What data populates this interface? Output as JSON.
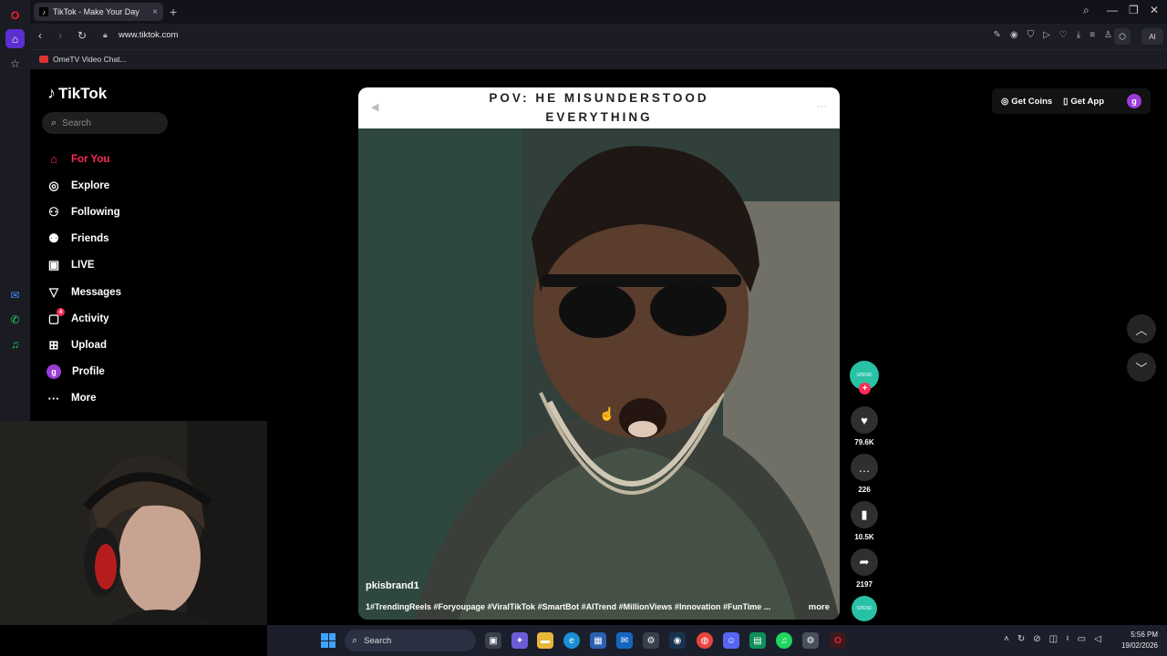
{
  "browser": {
    "tab_title": "TikTok - Make Your Day",
    "url": "www.tiktok.com",
    "bookmark": "OmeTV Video Chat...",
    "ai_label": "AI"
  },
  "tiktok": {
    "logo": "TikTok",
    "search_placeholder": "Search",
    "nav": [
      {
        "label": "For You",
        "icon": "home-icon"
      },
      {
        "label": "Explore",
        "icon": "compass-icon"
      },
      {
        "label": "Following",
        "icon": "following-icon"
      },
      {
        "label": "Friends",
        "icon": "friends-icon"
      },
      {
        "label": "LIVE",
        "icon": "live-icon"
      },
      {
        "label": "Messages",
        "icon": "messages-icon"
      },
      {
        "label": "Activity",
        "icon": "activity-icon",
        "badge": "4"
      },
      {
        "label": "Upload",
        "icon": "upload-icon"
      },
      {
        "label": "Profile",
        "icon": "profile-avatar",
        "avatar": "g"
      },
      {
        "label": "More",
        "icon": "more-icon"
      }
    ],
    "top_right": {
      "get_coins": "Get Coins",
      "get_app": "Get App",
      "avatar": "g"
    },
    "video": {
      "caption_line1": "POV: HE MISUNDERSTOOD",
      "caption_line2": "EVERYTHING",
      "username": "pkisbrand1",
      "hashtags": "1#TrendingReels #Foryoupage #ViralTikTok #SmartBot #AITrend #MillionViews #Innovation #FunTime ...",
      "more_label": "more"
    },
    "actions": {
      "likes": "79.6K",
      "comments": "226",
      "saves": "10.5K",
      "shares": "2197"
    }
  },
  "taskbar": {
    "search_label": "Search",
    "time": "5:56 PM",
    "date": "19/02/2026"
  },
  "colors": {
    "tiktok_red": "#fe2c55",
    "avatar_purple": "#9b3bd6",
    "creator_teal": "#29c1a6"
  }
}
